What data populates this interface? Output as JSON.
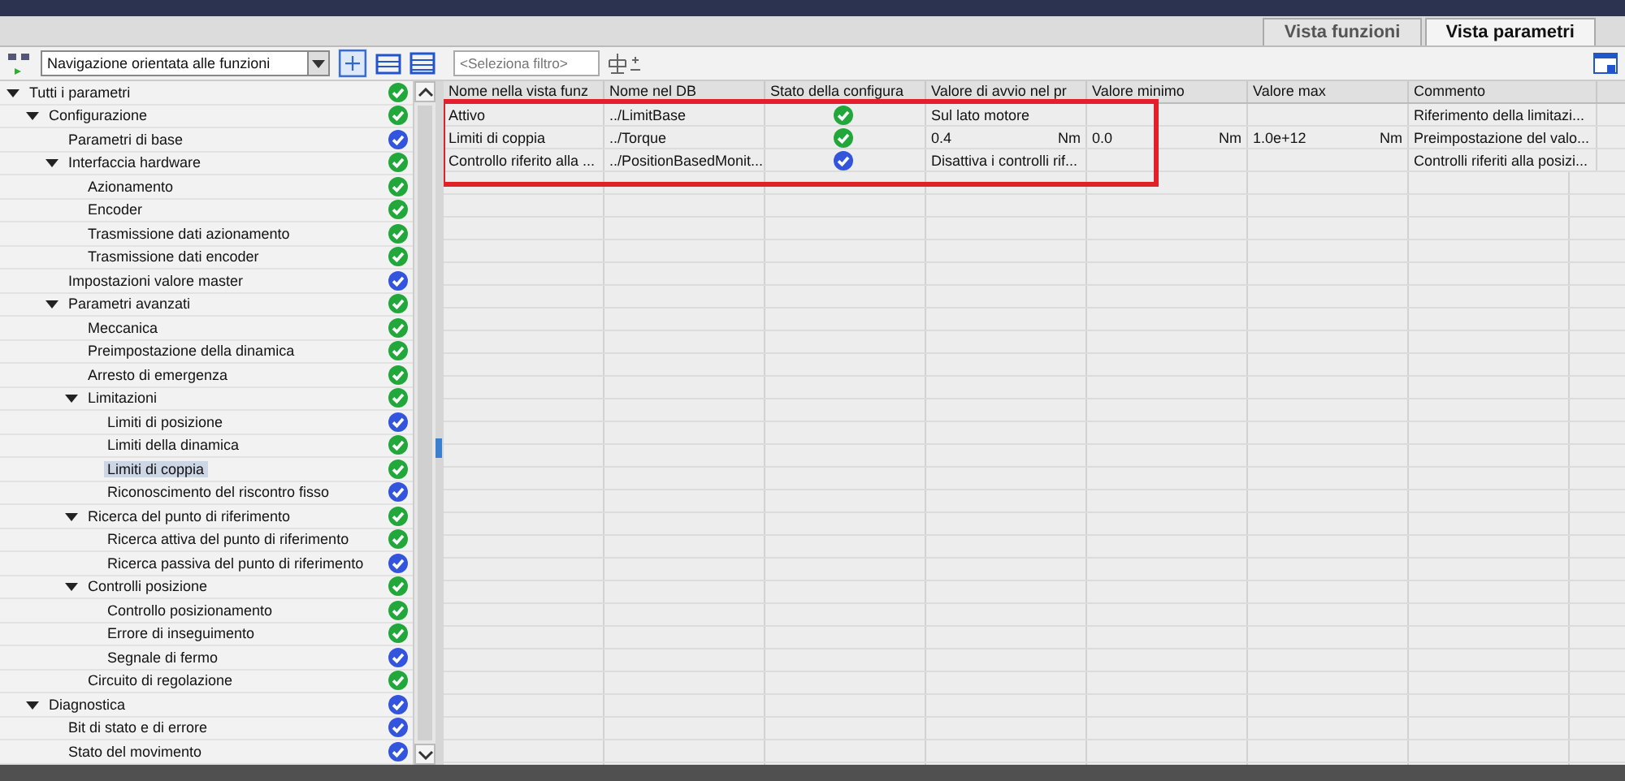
{
  "view_tabs": [
    {
      "label": "Vista funzioni",
      "selected": false
    },
    {
      "label": "Vista parametri",
      "selected": true
    }
  ],
  "toolbar": {
    "navigation": "Navigazione orientata alle funzioni",
    "filter_placeholder": "<Seleziona filtro>"
  },
  "tree": [
    {
      "label": "Tutti i parametri",
      "color": "#22a83a",
      "expanded": true,
      "selected": false,
      "children": [
        {
          "label": "Configurazione",
          "color": "#22a83a",
          "expanded": true,
          "selected": false,
          "children": [
            {
              "label": "Parametri di base",
              "color": "#3355dd",
              "selected": false
            },
            {
              "label": "Interfaccia hardware",
              "color": "#22a83a",
              "expanded": true,
              "selected": false,
              "children": [
                {
                  "label": "Azionamento",
                  "color": "#22a83a",
                  "selected": false
                },
                {
                  "label": "Encoder",
                  "color": "#22a83a",
                  "selected": false
                },
                {
                  "label": "Trasmissione dati azionamento",
                  "color": "#22a83a",
                  "selected": false
                },
                {
                  "label": "Trasmissione dati encoder",
                  "color": "#22a83a",
                  "selected": false
                }
              ]
            },
            {
              "label": "Impostazioni valore master",
              "color": "#3355dd",
              "selected": false
            },
            {
              "label": "Parametri avanzati",
              "color": "#22a83a",
              "expanded": true,
              "selected": false,
              "children": [
                {
                  "label": "Meccanica",
                  "color": "#22a83a",
                  "selected": false
                },
                {
                  "label": "Preimpostazione della dinamica",
                  "color": "#22a83a",
                  "selected": false
                },
                {
                  "label": "Arresto di emergenza",
                  "color": "#22a83a",
                  "selected": false
                },
                {
                  "label": "Limitazioni",
                  "color": "#22a83a",
                  "expanded": true,
                  "selected": false,
                  "children": [
                    {
                      "label": "Limiti di posizione",
                      "color": "#3355dd",
                      "selected": false
                    },
                    {
                      "label": "Limiti della dinamica",
                      "color": "#22a83a",
                      "selected": false
                    },
                    {
                      "label": "Limiti di coppia",
                      "color": "#22a83a",
                      "selected": true
                    },
                    {
                      "label": "Riconoscimento del riscontro fisso",
                      "color": "#3355dd",
                      "selected": false
                    }
                  ]
                },
                {
                  "label": "Ricerca del punto di riferimento",
                  "color": "#22a83a",
                  "expanded": true,
                  "selected": false,
                  "children": [
                    {
                      "label": "Ricerca attiva del punto di riferimento",
                      "color": "#22a83a",
                      "selected": false
                    },
                    {
                      "label": "Ricerca passiva del punto di riferimento",
                      "color": "#3355dd",
                      "selected": false
                    }
                  ]
                },
                {
                  "label": "Controlli posizione",
                  "color": "#22a83a",
                  "expanded": true,
                  "selected": false,
                  "children": [
                    {
                      "label": "Controllo posizionamento",
                      "color": "#22a83a",
                      "selected": false
                    },
                    {
                      "label": "Errore di inseguimento",
                      "color": "#22a83a",
                      "selected": false
                    },
                    {
                      "label": "Segnale di fermo",
                      "color": "#3355dd",
                      "selected": false
                    }
                  ]
                },
                {
                  "label": "Circuito di regolazione",
                  "color": "#22a83a",
                  "selected": false
                }
              ]
            }
          ]
        },
        {
          "label": "Diagnostica",
          "color": "#3355dd",
          "expanded": true,
          "selected": false,
          "children": [
            {
              "label": "Bit di stato e di errore",
              "color": "#3355dd",
              "selected": false
            },
            {
              "label": "Stato del movimento",
              "color": "#3355dd",
              "selected": false
            }
          ]
        }
      ]
    }
  ],
  "table": {
    "columns": [
      "Nome nella vista funz",
      "Nome nel DB",
      "Stato della configura",
      "Valore di avvio nel pr",
      "Valore minimo",
      "Valore max",
      "Commento"
    ],
    "rows": [
      {
        "function_name": "Attivo",
        "db_name": "../LimitBase",
        "color": "#22a83a",
        "start_value": "Sul lato motore",
        "comment": "Riferimento della limitazi..."
      },
      {
        "function_name": "Limiti di coppia",
        "db_name": "../Torque",
        "color": "#22a83a",
        "start_value": "0.4",
        "start_unit": "Nm",
        "min": "0.0",
        "min_unit": "Nm",
        "max": "1.0e+12",
        "max_unit": "Nm",
        "comment": "Preimpostazione del valo..."
      },
      {
        "function_name": "Controllo riferito alla ...",
        "db_name": "../PositionBasedMonit...",
        "color": "#3355dd",
        "start_value": "Disattiva i controlli rif...",
        "comment": "Controlli riferiti alla posizi..."
      }
    ]
  }
}
